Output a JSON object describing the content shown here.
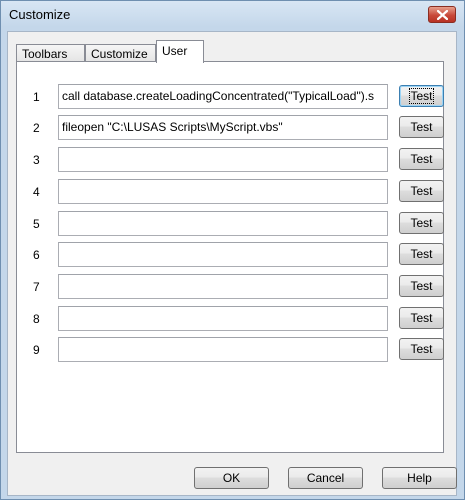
{
  "window": {
    "title": "Customize"
  },
  "tabs": [
    {
      "label": "Toolbars"
    },
    {
      "label": "Customize"
    },
    {
      "label": "User"
    }
  ],
  "active_tab": "User",
  "rows": [
    {
      "number": "1",
      "value": "call database.createLoadingConcentrated(\"TypicalLoad\").s",
      "button": "Test"
    },
    {
      "number": "2",
      "value": "fileopen \"C:\\LUSAS Scripts\\MyScript.vbs\"",
      "button": "Test"
    },
    {
      "number": "3",
      "value": "",
      "button": "Test"
    },
    {
      "number": "4",
      "value": "",
      "button": "Test"
    },
    {
      "number": "5",
      "value": "",
      "button": "Test"
    },
    {
      "number": "6",
      "value": "",
      "button": "Test"
    },
    {
      "number": "7",
      "value": "",
      "button": "Test"
    },
    {
      "number": "8",
      "value": "",
      "button": "Test"
    },
    {
      "number": "9",
      "value": "",
      "button": "Test"
    }
  ],
  "footer": {
    "ok": "OK",
    "cancel": "Cancel",
    "help": "Help"
  }
}
